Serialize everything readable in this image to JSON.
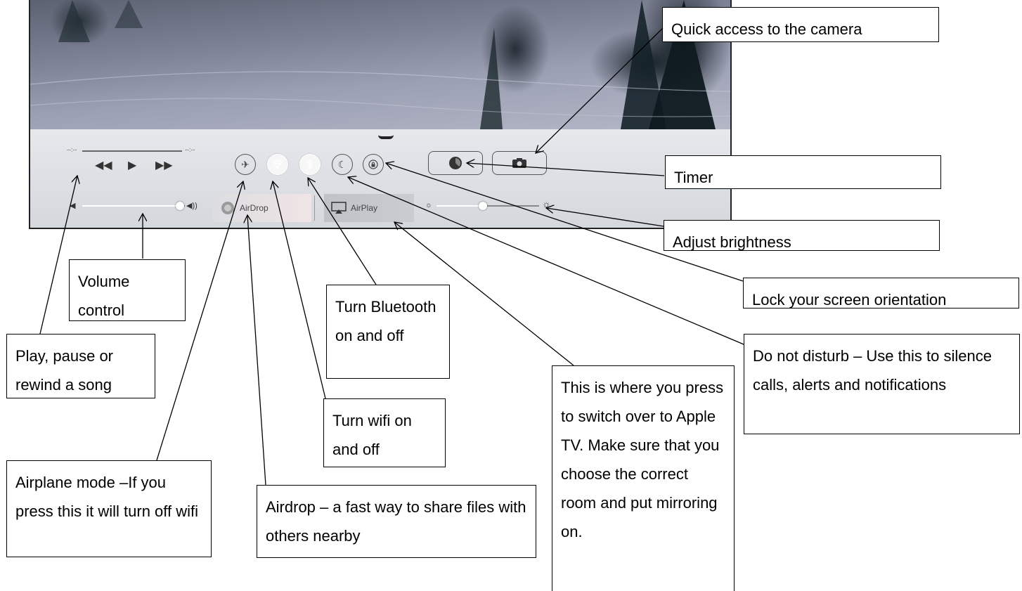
{
  "screenshot": {
    "airdrop_label": "AirDrop",
    "airplay_label": "AirPlay",
    "elapsed_time": "--:--",
    "remaining_time": "--:--",
    "volume_level": 0.95,
    "brightness_level": 0.45,
    "icons": {
      "airplane": "airplane-icon",
      "wifi": "wifi-icon",
      "bluetooth": "bluetooth-icon",
      "do_not_disturb": "moon-icon",
      "rotation_lock": "lock-rotation-icon",
      "timer": "timer-icon",
      "camera": "camera-icon"
    }
  },
  "callouts": {
    "camera": "Quick access to the camera",
    "timer": "Timer",
    "brightness": "Adjust brightness",
    "rotation_lock": "Lock your screen orientation",
    "volume": "Volume control",
    "bluetooth": "Turn Bluetooth on and off",
    "do_not_disturb": "Do not disturb – Use this to silence calls, alerts and notifications",
    "play": "Play, pause or rewind a song",
    "wifi": "Turn wifi on and off",
    "airplay": "This is where you press to switch over to Apple TV. Make sure that you choose the correct room and put mirroring on.",
    "airplane": "Airplane mode –If you press this it will turn off wifi",
    "airdrop": "Airdrop – a fast way to share files with others nearby"
  }
}
